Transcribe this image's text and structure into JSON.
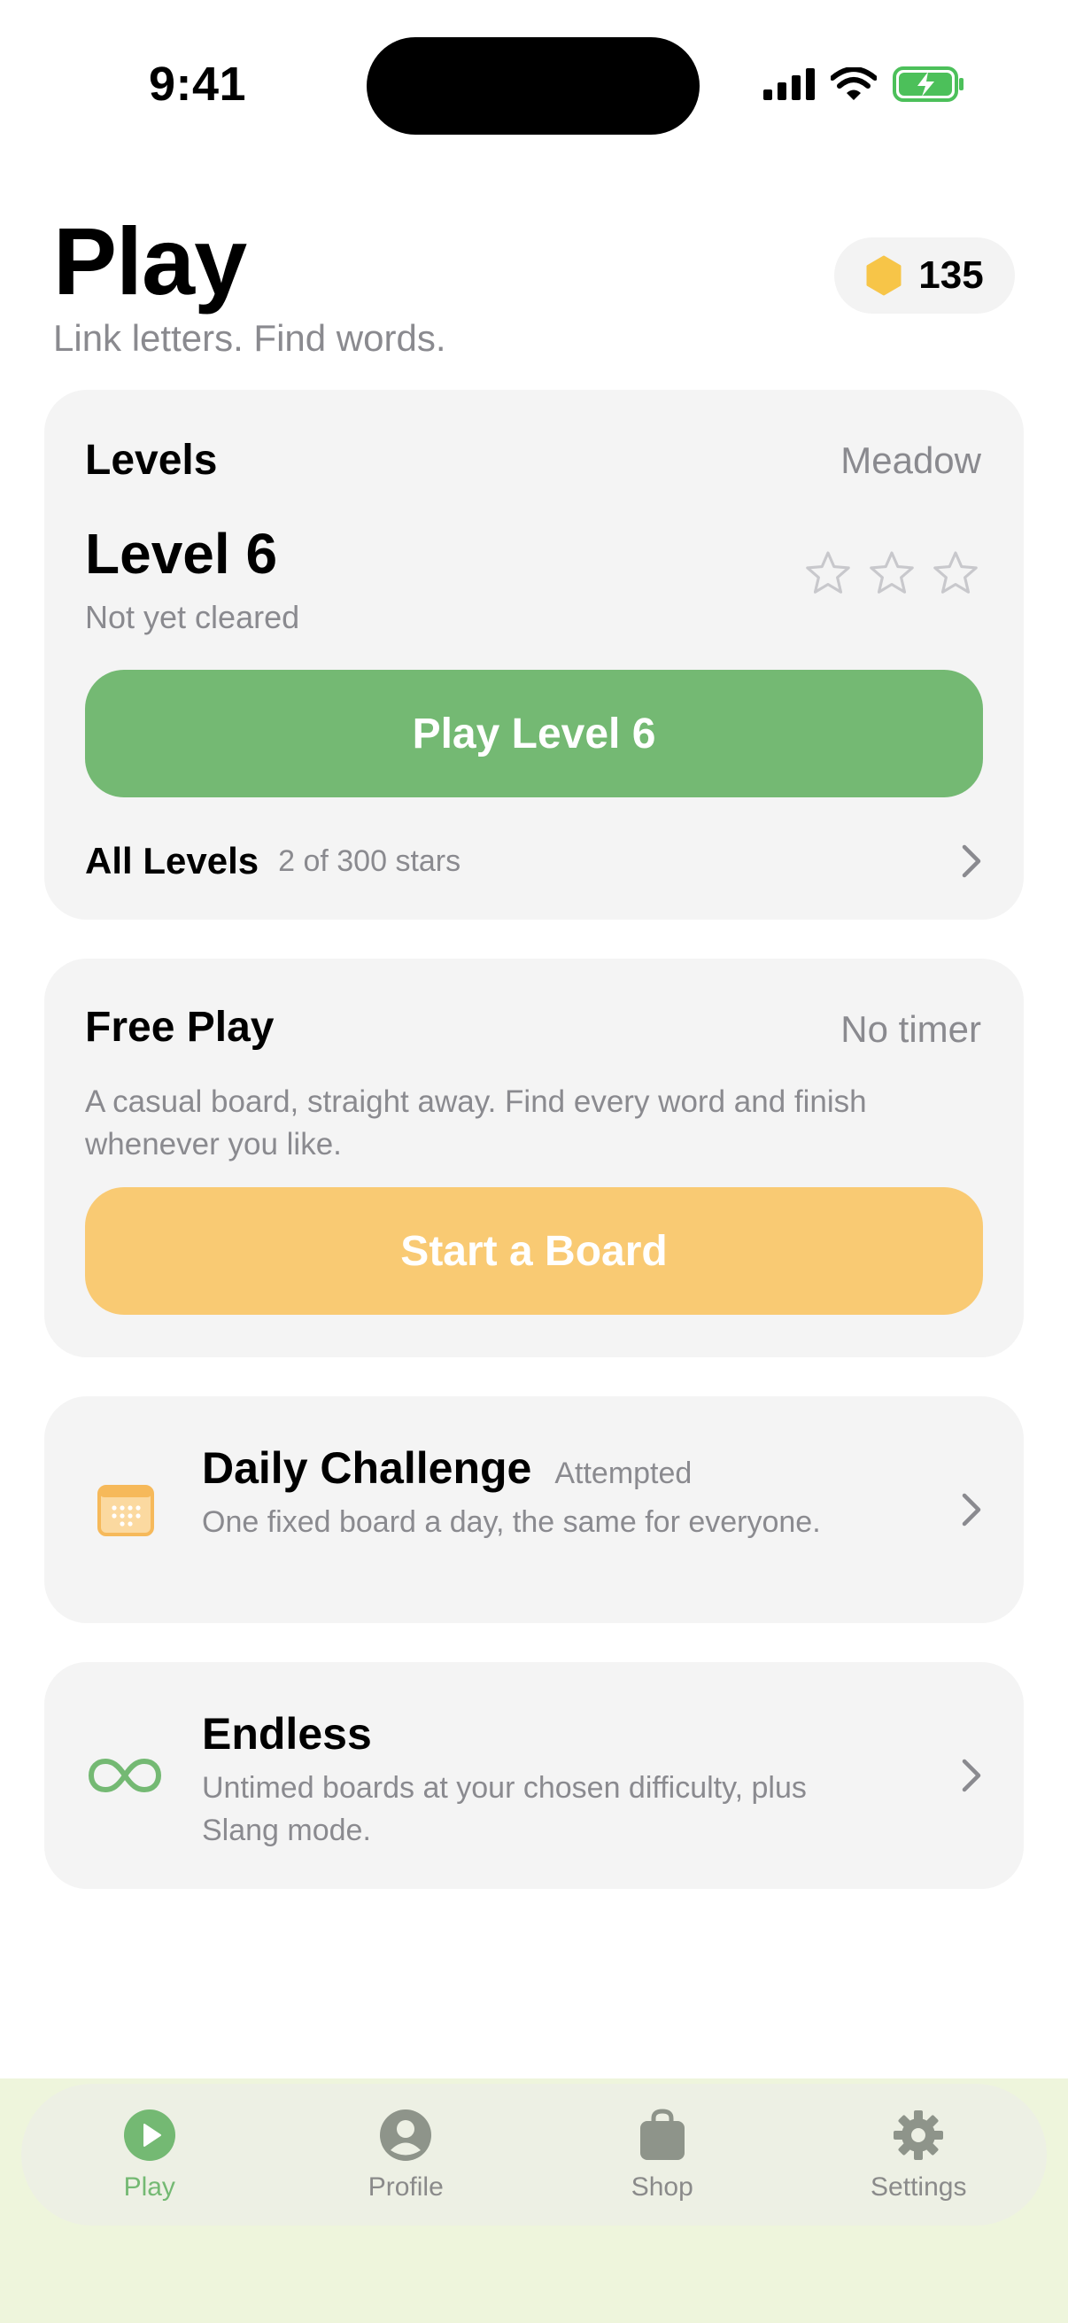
{
  "status_bar": {
    "time": "9:41"
  },
  "header": {
    "title": "Play",
    "subtitle": "Link letters. Find words.",
    "coins": "135"
  },
  "levels_card": {
    "heading": "Levels",
    "world": "Meadow",
    "level_title": "Level 6",
    "level_status": "Not yet cleared",
    "stars_earned": 0,
    "stars_total": 3,
    "play_button": "Play Level 6",
    "all_levels_label": "All Levels",
    "all_levels_stars": "2 of 300 stars"
  },
  "free_play_card": {
    "heading": "Free Play",
    "meta": "No timer",
    "description": "A casual board, straight away. Find every word and finish whenever you like.",
    "button": "Start a Board"
  },
  "daily_card": {
    "title": "Daily Challenge",
    "badge": "Attempted",
    "description": "One fixed board a day, the same for everyone.",
    "icon": "calendar-icon"
  },
  "endless_card": {
    "title": "Endless",
    "description": "Untimed boards at your chosen difficulty, plus Slang mode.",
    "icon": "infinity-icon"
  },
  "tabs": [
    {
      "label": "Play",
      "icon": "play-icon",
      "active": true
    },
    {
      "label": "Profile",
      "icon": "person-icon",
      "active": false
    },
    {
      "label": "Shop",
      "icon": "bag-icon",
      "active": false
    },
    {
      "label": "Settings",
      "icon": "gear-icon",
      "active": false
    }
  ],
  "colors": {
    "accent_green": "#74b973",
    "accent_yellow": "#f9ca73",
    "coin": "#f7c548",
    "tab_inactive": "#8e948a"
  }
}
